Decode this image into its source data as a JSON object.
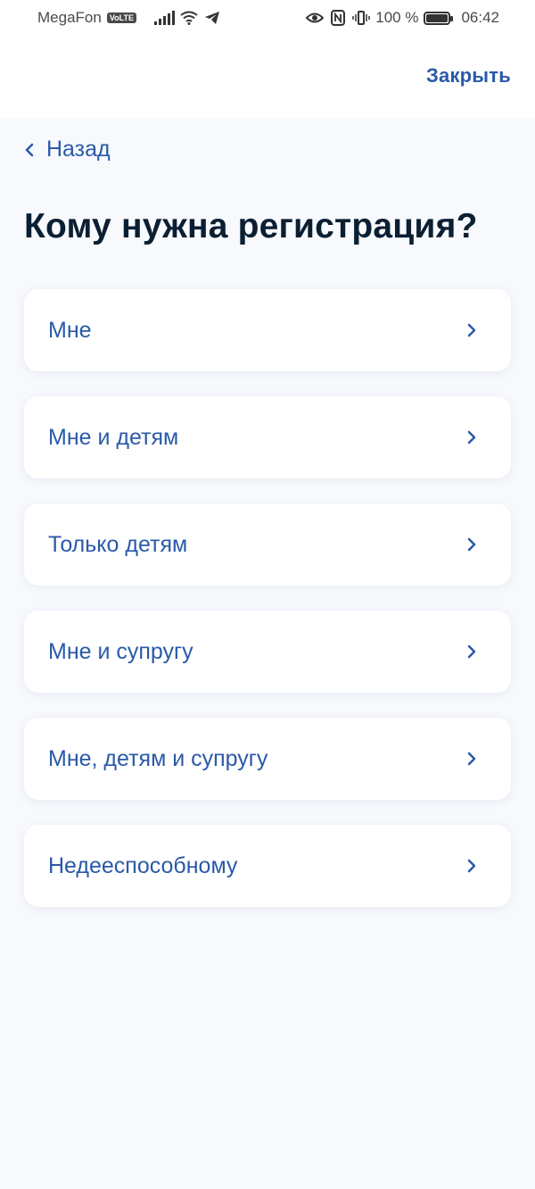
{
  "status_bar": {
    "carrier": "MegaFon",
    "network_badge": "VoLTE",
    "battery": "100 %",
    "time": "06:42",
    "icons": [
      "signal-icon",
      "wifi-icon",
      "telegram-icon",
      "eye-icon",
      "nfc-icon",
      "vibrate-icon",
      "battery-icon"
    ]
  },
  "header": {
    "close_label": "Закрыть"
  },
  "nav": {
    "back_label": "Назад"
  },
  "page": {
    "title": "Кому нужна регистрация?"
  },
  "options": [
    {
      "label": "Мне"
    },
    {
      "label": "Мне и детям"
    },
    {
      "label": "Только детям"
    },
    {
      "label": "Мне и супругу"
    },
    {
      "label": "Мне, детям и супругу"
    },
    {
      "label": "Недееспособному"
    }
  ],
  "colors": {
    "accent": "#2a59a8",
    "title": "#0b1f33",
    "background": "#f7f9fd",
    "card": "#ffffff"
  }
}
